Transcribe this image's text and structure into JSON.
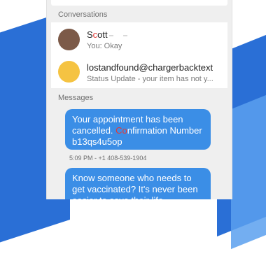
{
  "sections": {
    "conversations_label": "Conversations",
    "messages_label": "Messages"
  },
  "conversations": [
    {
      "name_prefix": "S",
      "name_highlight": "c",
      "name_rest": "ott",
      "preview": "You: Okay",
      "avatar_color": "#7c5a48"
    },
    {
      "name": "lostandfound@chargerbacktext",
      "preview": "Status Update - your item has not y...",
      "avatar_color": "#f5c342"
    }
  ],
  "messages": [
    {
      "text_a": "Your appointment has been cancelled. ",
      "text_highlight": "Co",
      "text_b": "nfirmation Number b13qs4u5op",
      "meta": "5:09 PM - +1 408-539-1904"
    },
    {
      "text": "Know someone who needs to get vaccinated? It's never been easier to save their life"
    }
  ],
  "colors": {
    "accent_blue": "#2a6fd6",
    "bubble_blue": "#3b8ee6",
    "highlight_red": "#e53935"
  }
}
